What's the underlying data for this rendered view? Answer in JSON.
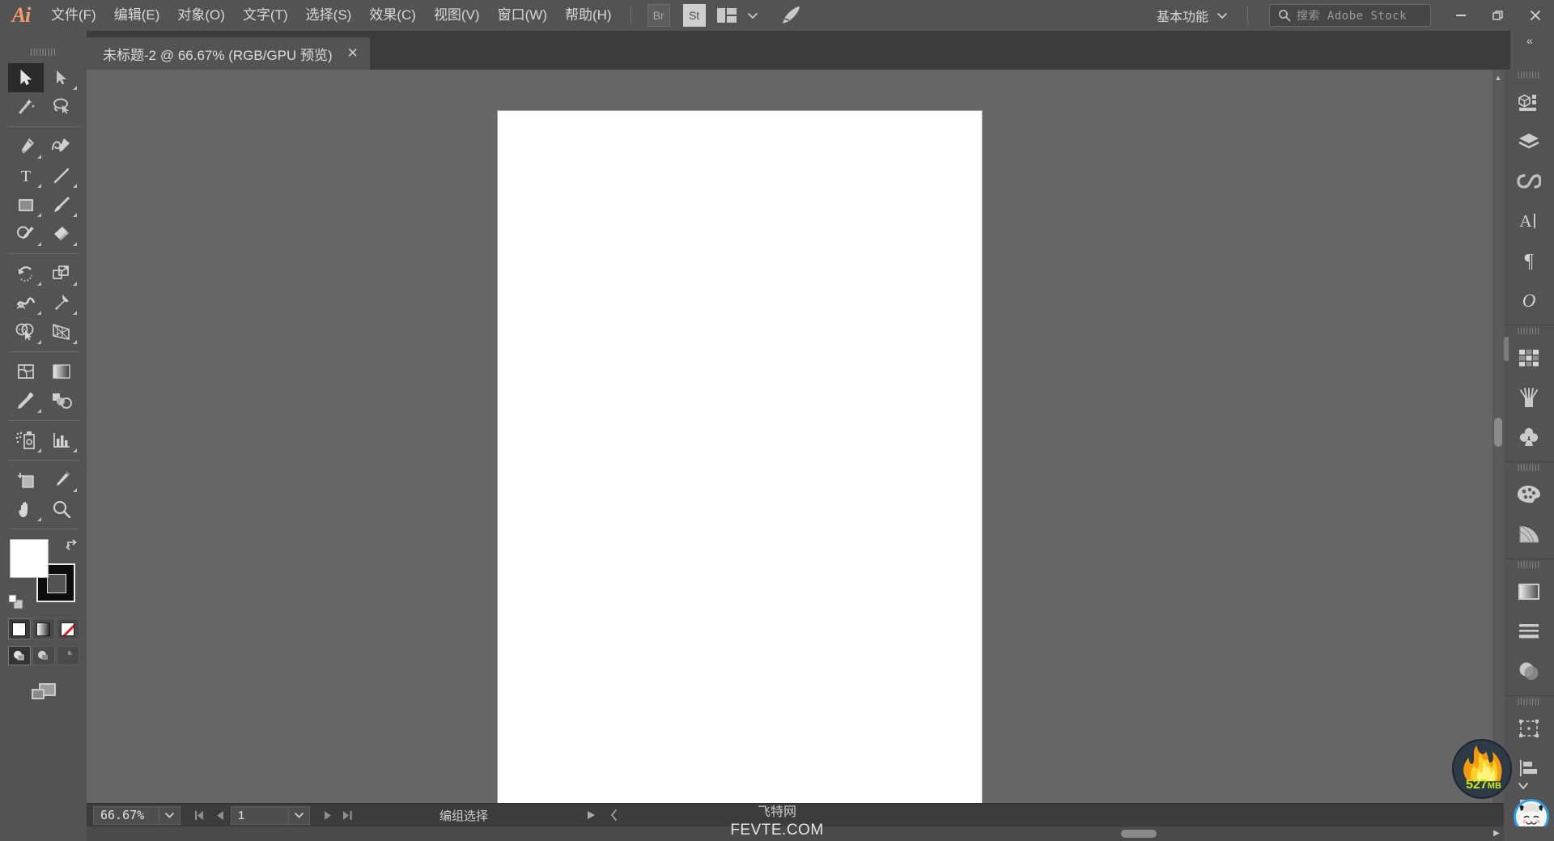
{
  "app": {
    "name": "Adobe Illustrator",
    "logo_text": "Ai"
  },
  "menubar": {
    "items": [
      {
        "label": "文件(F)",
        "name": "menu-file"
      },
      {
        "label": "编辑(E)",
        "name": "menu-edit"
      },
      {
        "label": "对象(O)",
        "name": "menu-object"
      },
      {
        "label": "文字(T)",
        "name": "menu-type"
      },
      {
        "label": "选择(S)",
        "name": "menu-select"
      },
      {
        "label": "效果(C)",
        "name": "menu-effect"
      },
      {
        "label": "视图(V)",
        "name": "menu-view"
      },
      {
        "label": "窗口(W)",
        "name": "menu-window"
      },
      {
        "label": "帮助(H)",
        "name": "menu-help"
      }
    ],
    "bridge_label": "Br",
    "stock_label": "St",
    "arrange_icon": "arrange-documents-icon",
    "rocket_icon": "rocket-icon",
    "workspace": "基本功能",
    "workspace_caret": "chevron-down-icon",
    "search_placeholder": "搜索 Adobe Stock",
    "search_value": "",
    "window_minimize": "minimize-icon",
    "window_restore": "restore-icon",
    "window_close": "close-icon"
  },
  "tabbar": {
    "collapse_left": "«",
    "collapse_right": "«",
    "document_title": "未标题-2 @ 66.67% (RGB/GPU 预览)",
    "close_label": "✕"
  },
  "toolbar": {
    "grip": "|||||||||",
    "tools": [
      {
        "name": "selection-tool",
        "label": "选择工具",
        "icon": "arrow-solid-icon",
        "active": true,
        "corner": false
      },
      {
        "name": "direct-selection-tool",
        "label": "直接选择工具",
        "icon": "arrow-outline-icon",
        "active": false,
        "corner": true
      },
      {
        "name": "magic-wand-tool",
        "label": "魔棒工具",
        "icon": "magic-wand-icon",
        "active": false,
        "corner": false
      },
      {
        "name": "lasso-tool",
        "label": "套索工具",
        "icon": "lasso-icon",
        "active": false,
        "corner": false
      },
      {
        "name": "pen-tool",
        "label": "钢笔工具",
        "icon": "pen-icon",
        "active": false,
        "corner": true
      },
      {
        "name": "curvature-tool",
        "label": "曲率工具",
        "icon": "curvature-icon",
        "active": false,
        "corner": false
      },
      {
        "name": "type-tool",
        "label": "文字工具",
        "icon": "type-t-icon",
        "active": false,
        "corner": true
      },
      {
        "name": "line-segment-tool",
        "label": "直线段工具",
        "icon": "line-icon",
        "active": false,
        "corner": true
      },
      {
        "name": "rectangle-tool",
        "label": "矩形工具",
        "icon": "rectangle-icon",
        "active": false,
        "corner": true
      },
      {
        "name": "paintbrush-tool",
        "label": "画笔工具",
        "icon": "paintbrush-icon",
        "active": false,
        "corner": true
      },
      {
        "name": "shaper-tool",
        "label": "Shaper 工具",
        "icon": "shaper-pencil-icon",
        "active": false,
        "corner": true
      },
      {
        "name": "eraser-tool",
        "label": "橡皮擦工具",
        "icon": "eraser-icon",
        "active": false,
        "corner": true
      },
      {
        "name": "rotate-tool",
        "label": "旋转工具",
        "icon": "rotate-icon",
        "active": false,
        "corner": true
      },
      {
        "name": "scale-tool",
        "label": "比例缩放工具",
        "icon": "scale-icon",
        "active": false,
        "corner": true
      },
      {
        "name": "width-tool",
        "label": "宽度工具",
        "icon": "width-warp-icon",
        "active": false,
        "corner": true
      },
      {
        "name": "free-transform-tool",
        "label": "自由变换工具",
        "icon": "pushpin-icon",
        "active": false,
        "corner": true
      },
      {
        "name": "shape-builder-tool",
        "label": "形状生成器工具",
        "icon": "shape-builder-icon",
        "active": false,
        "corner": true
      },
      {
        "name": "perspective-grid-tool",
        "label": "透视网格工具",
        "icon": "perspective-grid-icon",
        "active": false,
        "corner": true
      },
      {
        "name": "mesh-tool",
        "label": "网格工具",
        "icon": "mesh-icon",
        "active": false,
        "corner": false
      },
      {
        "name": "gradient-tool",
        "label": "渐变工具",
        "icon": "gradient-icon",
        "active": false,
        "corner": false
      },
      {
        "name": "eyedropper-tool",
        "label": "吸管工具",
        "icon": "eyedropper-icon",
        "active": false,
        "corner": true
      },
      {
        "name": "blend-tool",
        "label": "混合工具",
        "icon": "blend-icon",
        "active": false,
        "corner": false
      },
      {
        "name": "symbol-sprayer-tool",
        "label": "符号喷枪工具",
        "icon": "symbol-sprayer-icon",
        "active": false,
        "corner": true
      },
      {
        "name": "column-graph-tool",
        "label": "柱形图工具",
        "icon": "bar-graph-icon",
        "active": false,
        "corner": true
      },
      {
        "name": "artboard-tool",
        "label": "画板工具",
        "icon": "artboard-icon",
        "active": false,
        "corner": false
      },
      {
        "name": "slice-tool",
        "label": "切片工具",
        "icon": "slice-knife-icon",
        "active": false,
        "corner": true
      },
      {
        "name": "hand-tool",
        "label": "抓手工具",
        "icon": "hand-icon",
        "active": false,
        "corner": true
      },
      {
        "name": "zoom-tool",
        "label": "缩放工具",
        "icon": "magnifier-icon",
        "active": false,
        "corner": false
      }
    ],
    "fill_color": "#ffffff",
    "stroke_color": "#0c0c0c",
    "swap_icon": "swap-fill-stroke-icon",
    "default_icon": "default-fill-stroke-icon",
    "paint_modes": [
      {
        "name": "color-mode-button",
        "type": "color",
        "on": true
      },
      {
        "name": "gradient-mode-button",
        "type": "gradient",
        "on": false
      },
      {
        "name": "none-mode-button",
        "type": "none",
        "on": false
      }
    ],
    "draw_modes": [
      {
        "name": "draw-normal-button",
        "on": true
      },
      {
        "name": "draw-behind-button",
        "on": false
      },
      {
        "name": "draw-inside-button",
        "on": false
      }
    ],
    "screen_mode": "change-screen-mode-button"
  },
  "canvas": {
    "artboard_name": "artboard-1",
    "artboard_fill": "#ffffff",
    "background": "#666666"
  },
  "dock": {
    "collapse": "«",
    "groups": [
      {
        "grip": "||||||||",
        "items": [
          {
            "name": "panel-properties",
            "label": "属性",
            "icon": "properties-icon"
          },
          {
            "name": "panel-layers",
            "label": "图层",
            "icon": "layers-icon"
          },
          {
            "name": "panel-libraries",
            "label": "库",
            "icon": "cc-libraries-icon"
          },
          {
            "name": "panel-character",
            "label": "字符",
            "icon": "character-a-icon"
          },
          {
            "name": "panel-paragraph",
            "label": "段落",
            "icon": "paragraph-pilcrow-icon"
          },
          {
            "name": "panel-opentype",
            "label": "OpenType",
            "icon": "opentype-o-icon"
          }
        ]
      },
      {
        "grip": "||||||||",
        "items": [
          {
            "name": "panel-swatches",
            "label": "色板",
            "icon": "swatches-grid-icon"
          },
          {
            "name": "panel-brushes",
            "label": "画笔",
            "icon": "brushes-icon"
          },
          {
            "name": "panel-symbols",
            "label": "符号",
            "icon": "symbols-clover-icon"
          }
        ]
      },
      {
        "grip": "||||||||",
        "items": [
          {
            "name": "panel-color",
            "label": "颜色",
            "icon": "color-palette-icon"
          },
          {
            "name": "panel-color-guide",
            "label": "颜色参考",
            "icon": "color-guide-fan-icon"
          }
        ]
      },
      {
        "grip": "||||||||",
        "items": [
          {
            "name": "panel-gradient",
            "label": "渐变",
            "icon": "gradient-panel-icon"
          },
          {
            "name": "panel-stroke",
            "label": "描边",
            "icon": "stroke-lines-icon"
          },
          {
            "name": "panel-transparency",
            "label": "透明度",
            "icon": "transparency-circles-icon"
          }
        ]
      },
      {
        "grip": "||||||||",
        "items": [
          {
            "name": "panel-transform",
            "label": "变换",
            "icon": "transform-bbox-icon"
          },
          {
            "name": "panel-align",
            "label": "对齐",
            "icon": "align-left-icon"
          },
          {
            "name": "panel-pathfinder",
            "label": "路径查找器",
            "icon": "pathfinder-icon"
          }
        ]
      }
    ],
    "avatar": "user-avatar-cat"
  },
  "memory_badge": {
    "value": "527",
    "unit": "MB",
    "name": "memory-usage-badge",
    "caret": "chevron-down-icon"
  },
  "statusbar": {
    "zoom_value": "66.67%",
    "zoom_caret": "chevron-down-icon",
    "nav_first": "first-artboard-icon",
    "nav_prev": "previous-artboard-icon",
    "page_value": "1",
    "page_caret": "chevron-down-icon",
    "nav_next": "next-artboard-icon",
    "nav_last": "last-artboard-icon",
    "current_tool": "编组选择",
    "play_icon": "status-play-icon",
    "left_icon": "status-left-icon"
  },
  "watermark": {
    "line1": "飞特网",
    "line2": "FEVTE.COM"
  }
}
